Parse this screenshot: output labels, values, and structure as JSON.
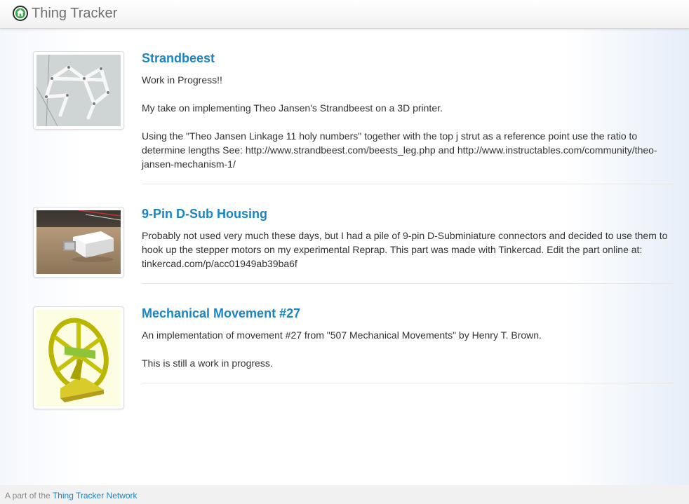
{
  "app": {
    "name": "Thing Tracker",
    "logo_icon": "house-globe-icon",
    "accent_color": "#1a85c4"
  },
  "things": [
    {
      "title": "Strandbeest",
      "thumb_icon": "strandbeest-linkage-render",
      "paragraphs": [
        "Work in Progress!!",
        "My take on implementing Theo Jansen's Strandbeest on a 3D printer.",
        "Using the \"Theo Jansen Linkage 11 holy numbers\" together with the top j strut as a reference point use the ratio to determine lengths See: http://www.strandbeest.com/beests_leg.php and http://www.instructables.com/community/theo-jansen-mechanism-1/"
      ]
    },
    {
      "title": "9-Pin D-Sub Housing",
      "thumb_icon": "dsub-housing-photo",
      "paragraphs": [
        "Probably not used very much these days, but I had a pile of 9-pin D-Subminiature connectors and decided to use them to hook up the stepper motors on my experimental Reprap. This part was made with Tinkercad. Edit the part online at: tinkercad.com/p/acc01949ab39ba6f"
      ]
    },
    {
      "title": "Mechanical Movement #27",
      "thumb_icon": "mechanical-wheel-render",
      "paragraphs": [
        "An implementation of movement #27 from \"507 Mechanical Movements\" by Henry T. Brown.",
        "This is still a work in progress."
      ]
    }
  ],
  "footer": {
    "prefix": "A part of the",
    "link_text": "Thing Tracker Network"
  }
}
